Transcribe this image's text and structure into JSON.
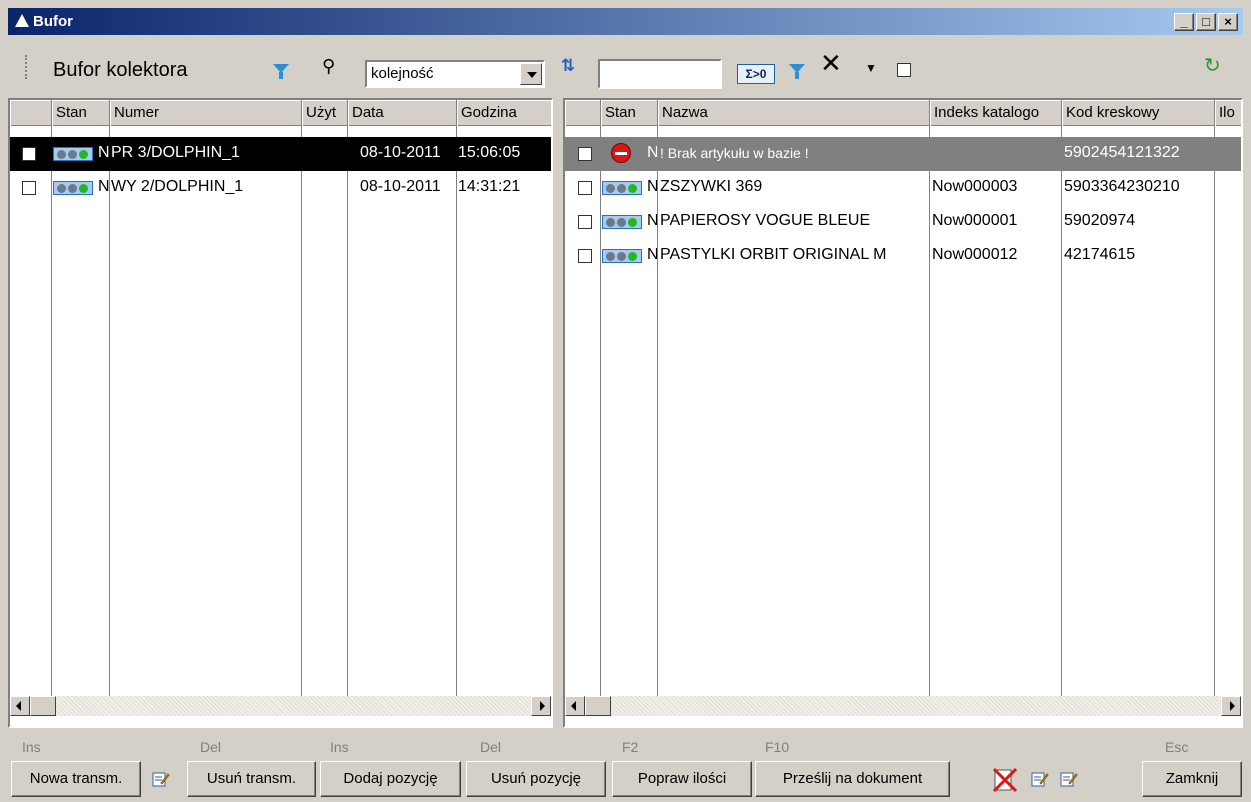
{
  "window": {
    "title": "Bufor"
  },
  "toolbar": {
    "title": "Bufor kolektora",
    "sort_value": "kolejność",
    "search_value": "",
    "sum_label": "Σ>0"
  },
  "left_grid": {
    "columns": [
      "Stan",
      "Numer",
      "Użyt",
      "Data",
      "Godzina"
    ],
    "rows": [
      {
        "stan": "N",
        "numer": "PR 3/DOLPHIN_1",
        "uzyt": "",
        "data": "08-10-2011",
        "godzina": "15:06:05",
        "selected": true
      },
      {
        "stan": "N",
        "numer": "WY 2/DOLPHIN_1",
        "uzyt": "",
        "data": "08-10-2011",
        "godzina": "14:31:21",
        "selected": false
      }
    ]
  },
  "right_grid": {
    "columns": [
      "Stan",
      "Nazwa",
      "Indeks katalogo",
      "Kod kreskowy",
      "Ilo"
    ],
    "rows": [
      {
        "stan": "N",
        "nazwa": "! Brak artykułu w bazie !",
        "indeks": "",
        "kod": "5902454121322",
        "status": "error"
      },
      {
        "stan": "N",
        "nazwa": "ZSZYWKI 369",
        "indeks": "Now000003",
        "kod": "5903364230210",
        "status": "ok"
      },
      {
        "stan": "N",
        "nazwa": "PAPIEROSY VOGUE BLEUE",
        "indeks": "Now000001",
        "kod": "59020974",
        "status": "ok"
      },
      {
        "stan": "N",
        "nazwa": "PASTYLKI ORBIT ORIGINAL M",
        "indeks": "Now000012",
        "kod": "42174615",
        "status": "ok"
      }
    ]
  },
  "bottom": {
    "keys": {
      "ins1": "Ins",
      "del1": "Del",
      "ins2": "Ins",
      "del2": "Del",
      "f2": "F2",
      "f10": "F10",
      "esc": "Esc"
    },
    "buttons": {
      "nowa": "Nowa transm.",
      "usun_transm": "Usuń transm.",
      "dodaj": "Dodaj pozycję",
      "usun_poz": "Usuń pozycję",
      "popraw": "Popraw ilości",
      "przeslij": "Prześlij na dokument",
      "zamknij": "Zamknij"
    }
  },
  "colors": {
    "title_start": "#0a246a",
    "title_end": "#a6caf0",
    "error": "#d81818",
    "status_green": "#22b822"
  }
}
